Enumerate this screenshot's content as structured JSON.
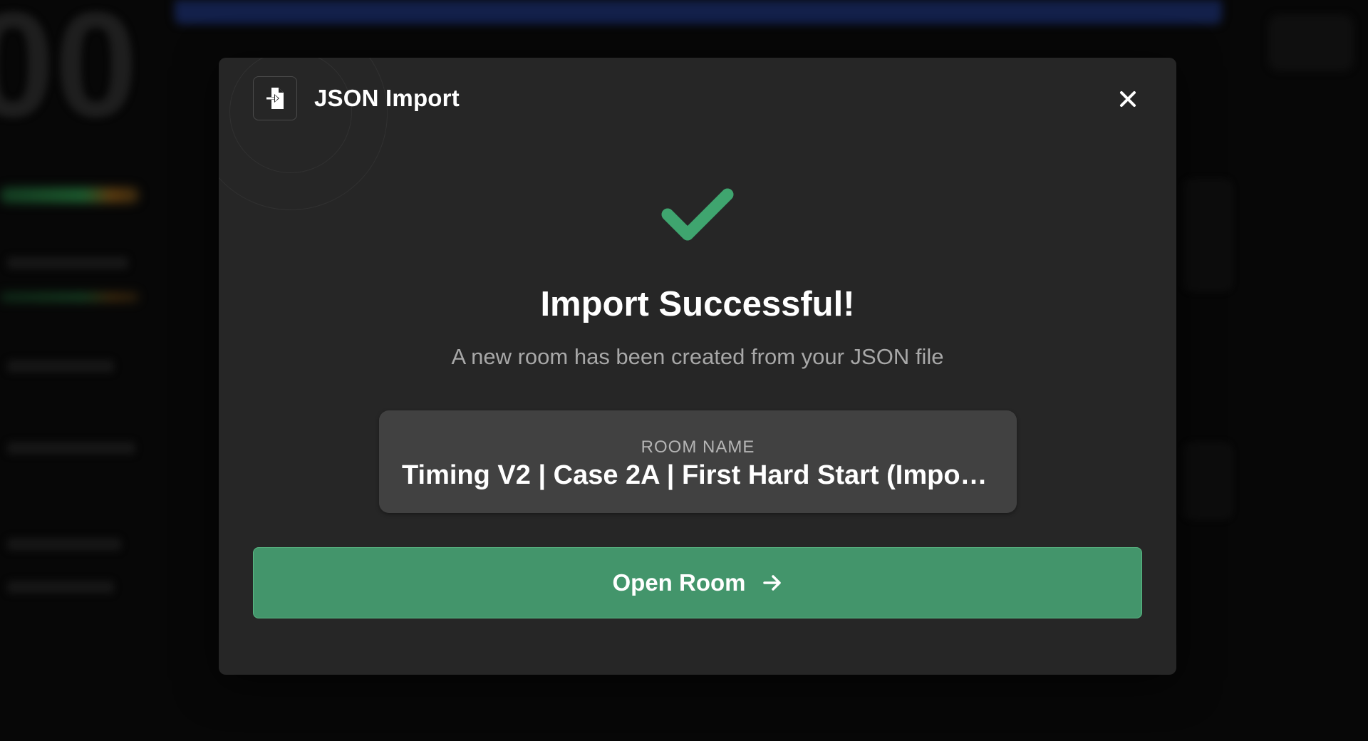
{
  "dialog": {
    "title": "JSON Import",
    "header_icon": "file-import-icon",
    "close_icon": "close-icon"
  },
  "result": {
    "status_icon": "checkmark-icon",
    "title": "Import Successful!",
    "subtitle": "A new room has been created from your JSON file"
  },
  "room": {
    "label": "ROOM NAME",
    "name": "Timing V2 | Case 2A | First Hard Start (Import..."
  },
  "actions": {
    "open_label": "Open Room",
    "open_icon": "arrow-right-icon"
  },
  "colors": {
    "accent": "#43956b",
    "check": "#3fa56f",
    "modal_bg": "#262626",
    "card_bg": "#414141"
  }
}
